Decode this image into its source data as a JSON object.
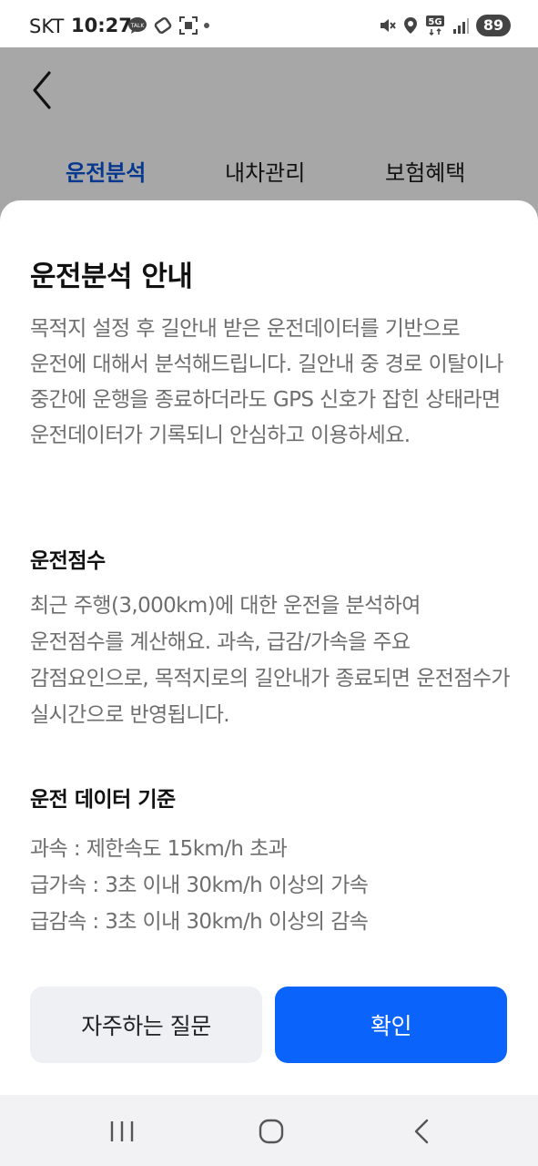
{
  "status_bar": {
    "carrier": "SKT",
    "time": "10:27",
    "battery": "89",
    "network": "5G"
  },
  "header": {
    "tabs": [
      {
        "label": "운전분석",
        "active": true
      },
      {
        "label": "내차관리",
        "active": false
      },
      {
        "label": "보험혜택",
        "active": false
      }
    ]
  },
  "sheet": {
    "title": "운전분석 안내",
    "description": "목적지 설정 후 길안내 받은 운전데이터를 기반으로 운전에 대해서 분석해드립니다. 길안내 중 경로 이탈이나 중간에 운행을 종료하더라도 GPS 신호가 잡힌 상태라면 운전데이터가 기록되니 안심하고 이용하세요.",
    "score_section": {
      "title": "운전점수",
      "body": "최근 주행(3,000km)에 대한 운전을 분석하여 운전점수를 계산해요. 과속, 급감/가속을 주요 감점요인으로, 목적지로의 길안내가 종료되면 운전점수가 실시간으로 반영됩니다."
    },
    "criteria_section": {
      "title": "운전 데이터 기준",
      "items": [
        "과속 : 제한속도 15km/h 초과",
        "급가속 : 3초 이내 30km/h 이상의 가속",
        "급감속 : 3초 이내 30km/h 이상의 감속"
      ]
    },
    "buttons": {
      "faq": "자주하는 질문",
      "confirm": "확인"
    }
  },
  "colors": {
    "accent": "#0a64fb",
    "active_tab": "#06388f",
    "dim_overlay": "#a7a7a7"
  }
}
